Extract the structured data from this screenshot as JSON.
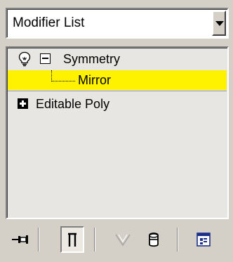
{
  "modifier_dropdown": {
    "selected": "Modifier List",
    "arrow_icon": "chevron-down-icon"
  },
  "stack": {
    "items": [
      {
        "label": "Symmetry",
        "icon": "lightbulb-icon",
        "expander": "collapse-minus-icon"
      },
      {
        "label": "Mirror",
        "selected": true
      },
      {
        "label": "Editable Poly",
        "expander": "expand-plus-icon"
      }
    ],
    "highlight_color": "#fff200",
    "background_color": "#e8e6e2"
  },
  "toolbar": {
    "buttons": [
      {
        "name": "pin-stack",
        "icon": "pin-icon"
      },
      {
        "name": "show-end-result",
        "icon": "show-end-result-icon",
        "pressed": true
      },
      {
        "name": "make-unique",
        "icon": "make-unique-icon",
        "disabled": true
      },
      {
        "name": "remove-modifier",
        "icon": "remove-modifier-icon"
      },
      {
        "name": "configure-modifier-sets",
        "icon": "configure-sets-icon"
      }
    ]
  }
}
